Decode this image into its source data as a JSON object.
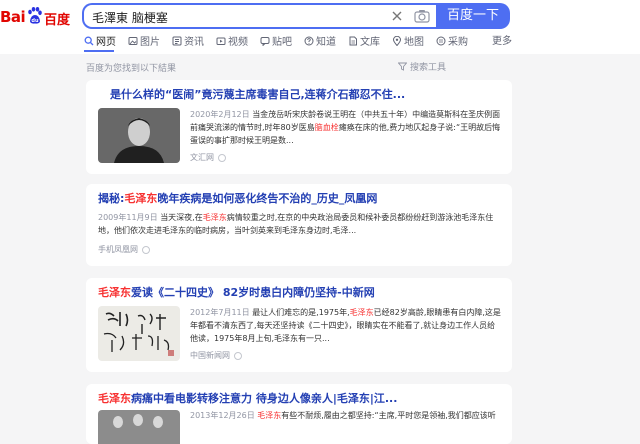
{
  "logo": {
    "latin": "Bai",
    "cn": "百度"
  },
  "search": {
    "query": "毛澤東 脑梗塞",
    "button_label": "百度一下"
  },
  "tabs": [
    {
      "label": "网页",
      "icon": "search-icon"
    },
    {
      "label": "图片",
      "icon": "image-icon"
    },
    {
      "label": "资讯",
      "icon": "news-icon"
    },
    {
      "label": "视频",
      "icon": "video-icon"
    },
    {
      "label": "贴吧",
      "icon": "tieba-icon"
    },
    {
      "label": "知道",
      "icon": "question-icon"
    },
    {
      "label": "文库",
      "icon": "document-icon"
    },
    {
      "label": "地图",
      "icon": "map-icon"
    },
    {
      "label": "采购",
      "icon": "cart-icon"
    },
    {
      "label": "更多",
      "icon": ""
    }
  ],
  "results_hint": "百度为您找到以下結果",
  "search_tools": "搜索工具",
  "results": [
    {
      "title": "是什么样的“医闹”竟污蔑主席毒害自己,连蒋介石都忍不住...",
      "date": "2020年2月12日",
      "snippet_before": "当金茂岳听宋庆龄卷说王明在（中共五十年）中编造莫斯科在圣庆例面前痛哭流涕的情节时,时年80岁医島",
      "snippet_highlight": "脑血栓",
      "snippet_after": "瘫痪在床的他,费力地仄起身子说:“王明故后悔蛋误的事扩那时候王明是数...",
      "source": "文汇网"
    },
    {
      "title_pre": "揭秘:",
      "title_highlight": "毛泽东",
      "title_post": "晚年疾病是如何恶化终告不治的_历史_凤凰网",
      "date": "2009年11月9日",
      "snippet_before": "当天深夜,在",
      "snippet_highlight": "毛泽东",
      "snippet_after": "病情较重之时,在京的中央政治局委员和候补委员都纷纷赶到游泳池毛泽东住地，他们依次走进毛泽东的临时病房，当叶剑英来到毛泽东身边时,毛泽...",
      "source": "手机凤凰网"
    },
    {
      "title_highlight": "毛泽东",
      "title_post": "爱读《二十四史》 82岁时患白内障仍坚持-中新网",
      "date": "2012年7月11日",
      "snippet_before": "最让人们难忘的是,1975年,",
      "snippet_highlight": "毛泽东",
      "snippet_after": "已经82岁高龄,眼睛患有白内障,这是年都看不清东西了,每天还坚持读《二十四史》，眼睛实在不能看了,就让身边工作人员给他读，1975年8月上旬,毛泽东有一只...",
      "source": "中国新闻网"
    },
    {
      "title_highlight": "毛泽东",
      "title_post": "病痛中看电影转移注意力 待身边人像亲人|毛泽东|江...",
      "date": "2013年12月26日",
      "snippet_before": "",
      "snippet_highlight": "毛泽东",
      "snippet_after": "有些不耐烦,履由之都坚持:“主席,平时您是领袖,我们都应该听您...",
      "source": ""
    }
  ],
  "colors": {
    "accent": "#4e6ef2",
    "title": "#2440b3",
    "highlight": "#f73131",
    "logo": "#e10602"
  }
}
